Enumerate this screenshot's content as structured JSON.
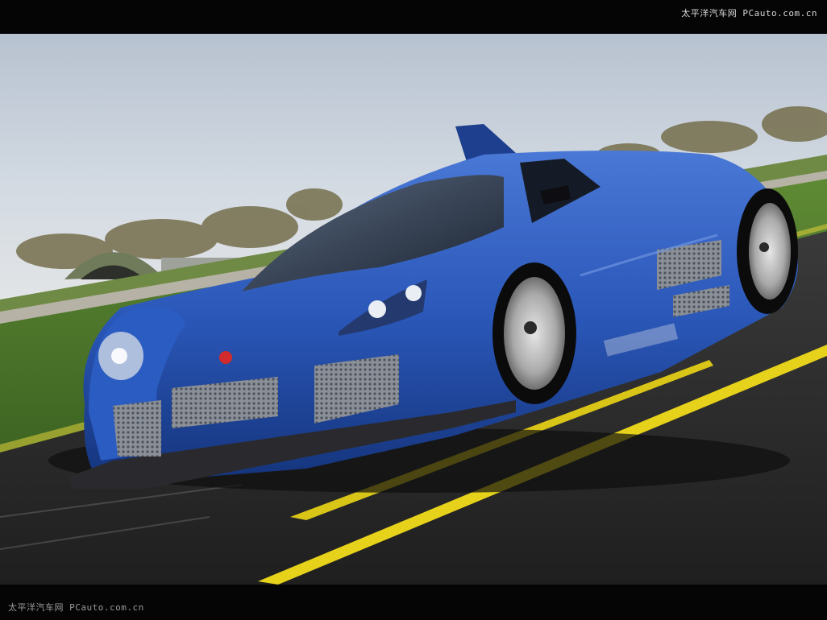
{
  "watermark": {
    "top": "太平洋汽车网 PCauto.com.cn",
    "bottom": "太平洋汽车网 PCauto.com.cn"
  },
  "photo": {
    "subject": "blue supercar on track",
    "colors": {
      "car_body": "#2a57b8",
      "car_dark": "#163a86",
      "sky": "#c9d3df",
      "grass": "#4f7b2c",
      "asphalt": "#2c2c2c",
      "lane_line": "#e7d21b"
    }
  }
}
